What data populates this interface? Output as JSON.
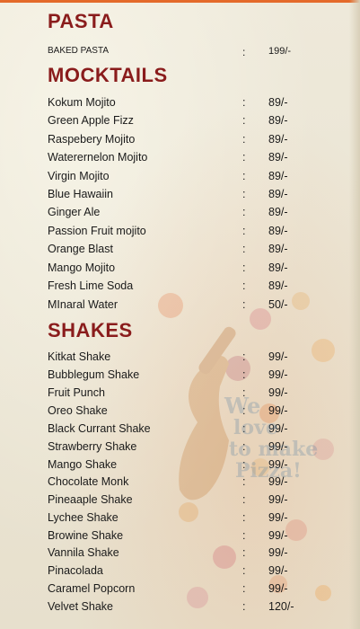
{
  "sections": [
    {
      "title": "PASTA",
      "items": [
        {
          "name": "BAKED PASTA",
          "colon": ":",
          "price": "199/-"
        }
      ]
    },
    {
      "title": "MOCKTAILS",
      "items": [
        {
          "name": "Kokum Mojito",
          "colon": ":",
          "price": "89/-"
        },
        {
          "name": "Green Apple Fizz",
          "colon": ":",
          "price": "89/-"
        },
        {
          "name": "Raspebery Mojito",
          "colon": ":",
          "price": "89/-"
        },
        {
          "name": "Waterernelon Mojito",
          "colon": ":",
          "price": "89/-"
        },
        {
          "name": "Virgin Mojito",
          "colon": ":",
          "price": "89/-"
        },
        {
          "name": "Blue Hawaiin",
          "colon": ":",
          "price": "89/-"
        },
        {
          "name": "Ginger Ale",
          "colon": ":",
          "price": "89/-"
        },
        {
          "name": "Passion Fruit mojito",
          "colon": ":",
          "price": "89/-"
        },
        {
          "name": "Orange Blast",
          "colon": ":",
          "price": "89/-"
        },
        {
          "name": "Mango Mojito",
          "colon": ":",
          "price": "89/-"
        },
        {
          "name": "Fresh Lime Soda",
          "colon": ":",
          "price": "89/-"
        },
        {
          "name": "MInaral Water",
          "colon": ":",
          "price": "50/-"
        }
      ]
    },
    {
      "title": "SHAKES",
      "items": [
        {
          "name": "Kitkat Shake",
          "colon": ":",
          "price": "99/-"
        },
        {
          "name": "Bubblegum Shake",
          "colon": ":",
          "price": "99/-"
        },
        {
          "name": "Fruit Punch",
          "colon": ":",
          "price": "99/-"
        },
        {
          "name": "Oreo Shake",
          "colon": ":",
          "price": "99/-"
        },
        {
          "name": "Black Currant Shake",
          "colon": ":",
          "price": "99/-"
        },
        {
          "name": "Strawberry Shake",
          "colon": ":",
          "price": "99/-"
        },
        {
          "name": "Mango Shake",
          "colon": ":",
          "price": "99/-"
        },
        {
          "name": "Chocolate Monk",
          "colon": ":",
          "price": "99/-"
        },
        {
          "name": "Pineaaple Shake",
          "colon": ":",
          "price": "99/-"
        },
        {
          "name": "Lychee Shake",
          "colon": ":",
          "price": "99/-"
        },
        {
          "name": "Browine Shake",
          "colon": ":",
          "price": "99/-"
        },
        {
          "name": "Vannila Shake",
          "colon": ":",
          "price": "99/-"
        },
        {
          "name": "Pinacolada",
          "colon": ":",
          "price": "99/-"
        },
        {
          "name": "Caramel Popcorn",
          "colon": ":",
          "price": "99/-"
        },
        {
          "name": "Velvet Shake",
          "colon": ":",
          "price": "120/-"
        }
      ]
    }
  ],
  "watermark": {
    "line1": "We",
    "line2": "love",
    "line3": "to make",
    "line4": "Pizza!"
  },
  "colors": {
    "heading": "#8a1c1c",
    "background": "#ece6d6",
    "accent": "#e46a2a"
  }
}
